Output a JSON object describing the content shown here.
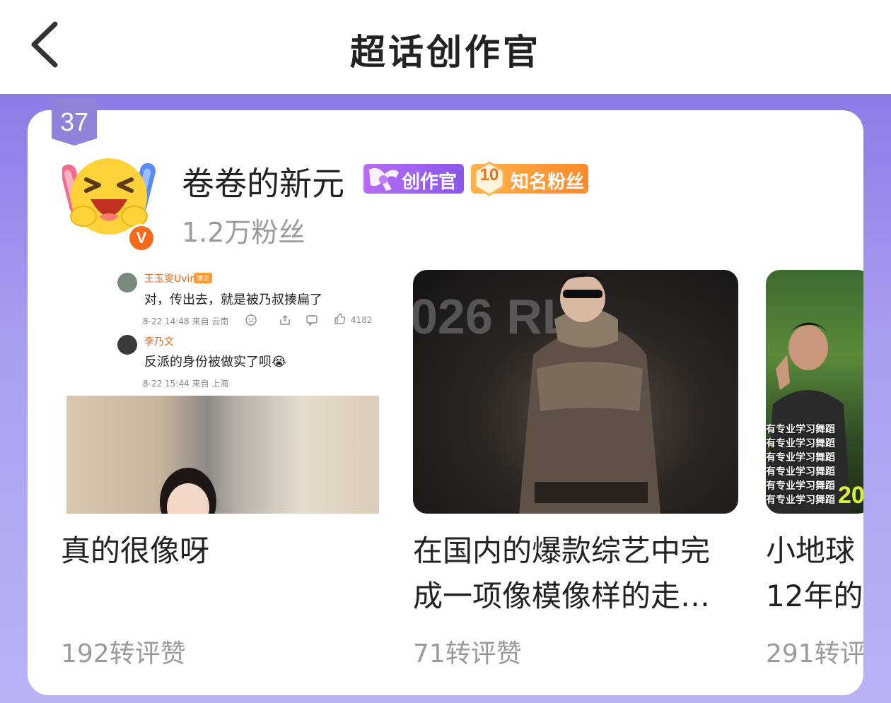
{
  "header": {
    "title": "超话创作官"
  },
  "profile": {
    "rank": "37",
    "username": "卷卷的新元",
    "fans": "1.2万粉丝",
    "verify_mark": "V",
    "badge_creator": "创作官",
    "badge_fan_level": "10",
    "badge_fan": "知名粉丝"
  },
  "posts": [
    {
      "title": "真的很像呀",
      "stats": "192转评赞",
      "comments": [
        {
          "name": "王玉雯Uvin",
          "tag": "博主",
          "text": "对，传出去，就是被乃叔揍扁了",
          "meta": "8-22 14:48 来自 云南",
          "likes": "4182"
        },
        {
          "name": "李乃文",
          "text": "反派的身份被做实了呗😭",
          "meta": "8-22 15:44 来自 上海"
        }
      ]
    },
    {
      "title": "在国内的爆款综艺中完成一项像模像样的走…",
      "title_line1": "在国内的爆款综艺中完",
      "title_line2": "成一项像模像样的走…",
      "stats": "71转评赞",
      "photo_text": "026 RL"
    },
    {
      "title_line1": "小地球",
      "title_line2": "12年的",
      "stats": "291转评",
      "photo_caption": "有专业学习舞蹈",
      "photo_number": "20"
    }
  ],
  "colors": {
    "accent_purple": "#8d7be6",
    "badge_orange": "#ff8a2a",
    "verify_orange": "#f36a1a"
  }
}
